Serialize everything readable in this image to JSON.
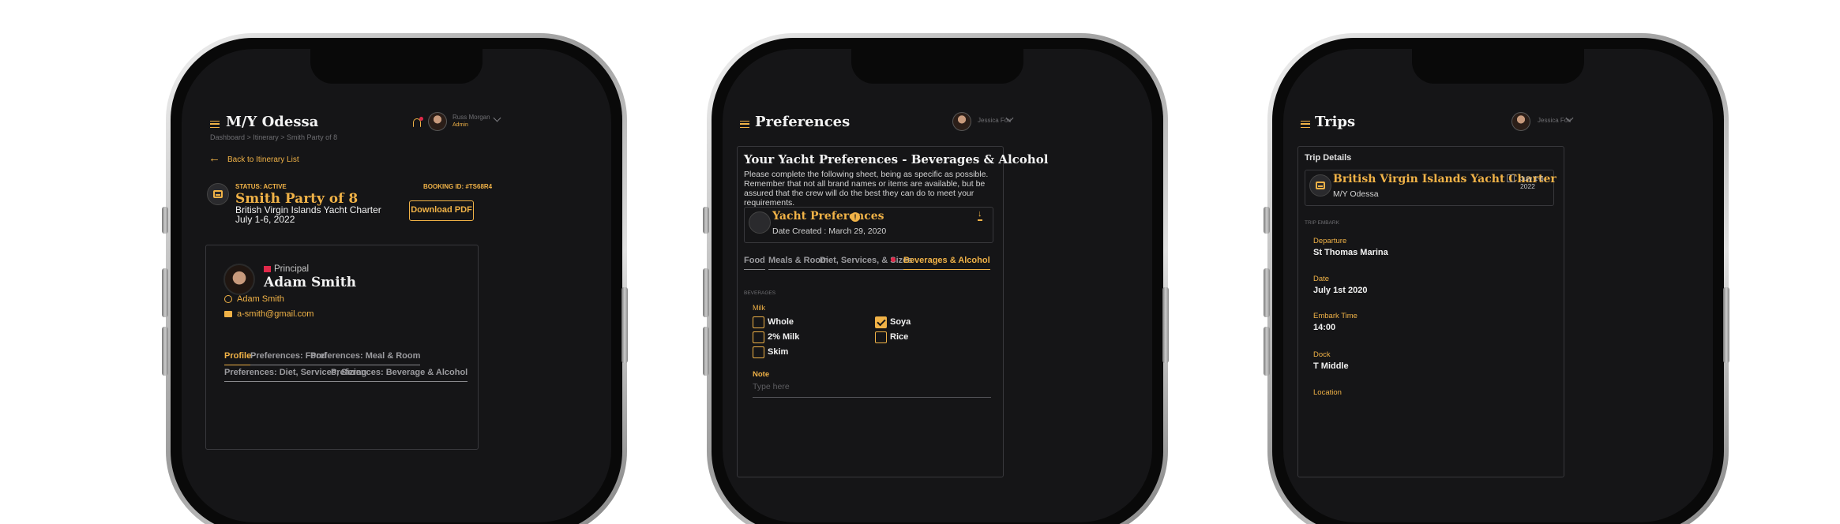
{
  "phone1": {
    "title": "M/Y Odessa",
    "breadcrumb": "Dashboard > Itinerary > Smith Party of 8",
    "user_name": "Russ Morgan",
    "user_role": "Admin",
    "back_label": "Back to Itinerary List",
    "status": "STATUS: ACTIVE",
    "booking_id": "BOOKING ID: #TS68R4",
    "party_name": "Smith Party of 8",
    "charter_name": "British Virgin Islands Yacht Charter",
    "dates": "July 1-6, 2022",
    "download_label": "Download PDF",
    "role_label": "Principal",
    "guest_name": "Adam Smith",
    "whatsapp": "Adam Smith",
    "email": "a-smith@gmail.com",
    "tabs": [
      "Profile",
      "Preferences: Food",
      "Preferences: Meal & Room",
      "Preferences: Diet, Services, Sizing",
      "Preferences: Beverage & Alcohol"
    ]
  },
  "phone2": {
    "title": "Preferences",
    "user_name": "Jessica Fox",
    "heading": "Your Yacht Preferences - Beverages & Alcohol",
    "intro": "Please complete the following sheet, being as specific as possible. Remember that not all brand names or items are available, but be assured that the crew will do the best they can do to meet your requirements.",
    "pref_title": "Yacht Preferences",
    "date_created": "Date Created : March 29, 2020",
    "tabs": [
      "Food",
      "Meals & Room",
      "Diet, Services, & Sizes",
      "Beverages & Alcohol"
    ],
    "section_label": "BEVERAGES",
    "group_label": "Milk",
    "options": [
      {
        "label": "Whole",
        "checked": false
      },
      {
        "label": "Soya",
        "checked": true
      },
      {
        "label": "2% Milk",
        "checked": false
      },
      {
        "label": "Rice",
        "checked": false
      },
      {
        "label": "Skim",
        "checked": false
      }
    ],
    "note_label": "Note",
    "note_placeholder": "Type here"
  },
  "phone3": {
    "title": "Trips",
    "user_name": "Jessica Fox",
    "card_title": "Trip Details",
    "trip_name": "British Virgin Islands Yacht Charter",
    "yacht": "M/Y Odessa",
    "dates": "July 1-6, 2022",
    "section_label": "TRIP EMBARK",
    "fields": [
      {
        "label": "Departure",
        "value": "St Thomas Marina"
      },
      {
        "label": "Date",
        "value": "July 1st 2020"
      },
      {
        "label": "Embark Time",
        "value": "14:00"
      },
      {
        "label": "Dock",
        "value": "T Middle"
      },
      {
        "label": "Location",
        "value": ""
      }
    ]
  },
  "colors": {
    "accent": "#f0b247",
    "background": "#151517",
    "alert": "#e0294a"
  }
}
